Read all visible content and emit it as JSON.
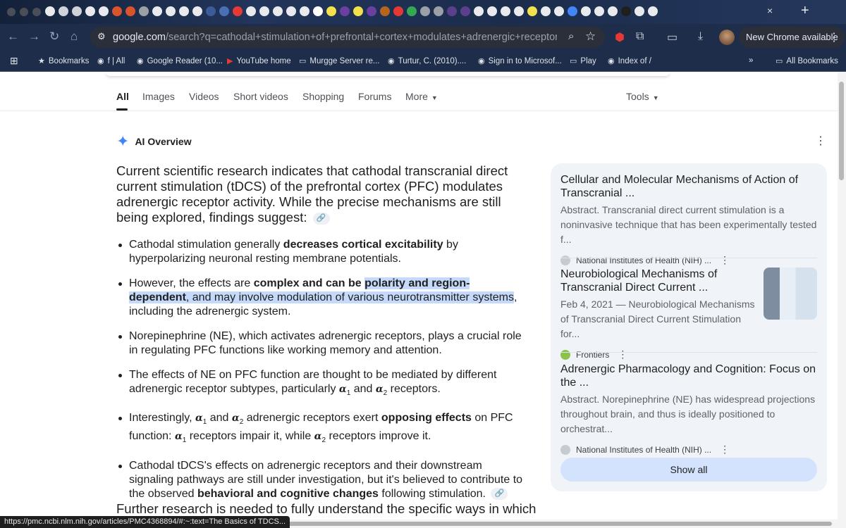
{
  "browser": {
    "url_domain": "google.com",
    "url_rest": "/search?q=cathodal+stimulation+of+prefrontal+cortex+modulates+adrenergic+receptor+does&sca_e...",
    "new_chrome_label": "New Chrome available",
    "tab_close_glyph": "×",
    "new_tab_glyph": "+"
  },
  "bookmarks": [
    {
      "label": "Bookmarks",
      "icon": "star-icon"
    },
    {
      "label": "f | All",
      "icon": "globe-icon"
    },
    {
      "label": "Google Reader (10...",
      "icon": "globe-icon"
    },
    {
      "label": "YouTube home",
      "icon": "youtube-icon"
    },
    {
      "label": "Murgge Server re...",
      "icon": "folder-icon"
    },
    {
      "label": "Turtur, C. (2010)....",
      "icon": "globe-icon"
    },
    {
      "label": "Sign in to Microsof...",
      "icon": "globe-icon"
    },
    {
      "label": "Play",
      "icon": "folder-icon"
    },
    {
      "label": "Index of /",
      "icon": "globe-icon"
    },
    {
      "label": "All Bookmarks",
      "icon": "folder-icon"
    }
  ],
  "search_tabs": [
    "All",
    "Images",
    "Videos",
    "Short videos",
    "Shopping",
    "Forums",
    "More",
    "Tools"
  ],
  "ai_overview": {
    "title": "AI Overview",
    "intro": "Current scientific research indicates that cathodal transcranial direct current stimulation (tDCS) of the prefrontal cortex (PFC) modulates adrenergic receptor activity. While the precise mechanisms are still being explored, findings suggest:",
    "b1_a": "Cathodal stimulation generally ",
    "b1_b": "decreases cortical excitability",
    "b1_c": " by hyperpolarizing neuronal resting membrane potentials.",
    "b2_a": "However, the effects are ",
    "b2_b": "complex and can be ",
    "b2_c": "polarity and region-dependent",
    "b2_d": ", and may involve modulation of various neurotransmitter systems",
    "b2_e": ", including the adrenergic system.",
    "b3": "Norepinephrine (NE), which activates adrenergic receptors, plays a crucial role in regulating PFC functions like working memory and attention.",
    "b4_a": "The effects of NE on PFC function are thought to be mediated by different adrenergic receptor subtypes, particularly ",
    "b4_b": " and ",
    "b4_c": " receptors.",
    "b5_a": "Interestingly, ",
    "b5_b": " and ",
    "b5_c": " adrenergic receptors exert ",
    "b5_d": "opposing effects",
    "b5_e": " on PFC function: ",
    "b5_f": " receptors impair it, while ",
    "b5_g": " receptors improve it.",
    "b6_a": "Cathodal tDCS's effects on adrenergic receptors and their downstream signaling pathways are still under investigation, but it's believed to contribute to the observed ",
    "b6_b": "behavioral and cognitive changes",
    "b6_c": " following stimulation.",
    "alpha": "α",
    "sub1": "1",
    "sub2": "2",
    "further": "Further research is needed to fully understand the specific ways in which"
  },
  "sources": [
    {
      "title": "Cellular and Molecular Mechanisms of Action of Transcranial ...",
      "snippet": "Abstract. Transcranial direct current stimulation is a noninvasive technique that has been experimentally tested f...",
      "site": "National Institutes of Health (NIH) ..."
    },
    {
      "title": "Neurobiological Mechanisms of Transcranial Direct Current ...",
      "snippet": "Feb 4, 2021 — Neurobiological Mechanisms of Transcranial Direct Current Stimulation for...",
      "site": "Frontiers"
    },
    {
      "title": "Adrenergic Pharmacology and Cognition: Focus on the ...",
      "snippet": "Abstract. Norepinephrine (NE) has widespread projections throughout brain, and thus is ideally positioned to orchestrat...",
      "site": "National Institutes of Health (NIH) ..."
    }
  ],
  "show_all_label": "Show all",
  "status_url": "https://pmc.ncbi.nlm.nih.gov/articles/PMC4368894/#:~:text=The Basics of TDCS...",
  "colors": {
    "accent": "#4285f4",
    "highlight": "#c5dafb",
    "chrome_bg": "#1e2d4a",
    "show_all_bg": "#d3e3fd"
  }
}
